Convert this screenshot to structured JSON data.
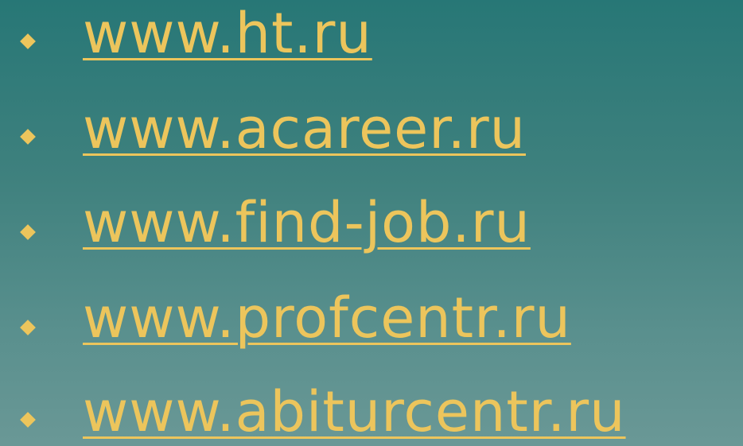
{
  "links": [
    "www.ht.ru",
    "www.acareer.ru",
    "www.find-job.ru",
    "www.profcentr.ru",
    "www.abiturcentr.ru"
  ],
  "colors": {
    "accent": "#ecc55c",
    "background_top": "#277776",
    "background_bottom": "#6a9896"
  },
  "icons": {
    "bullet": "diamond-bullet-icon"
  }
}
